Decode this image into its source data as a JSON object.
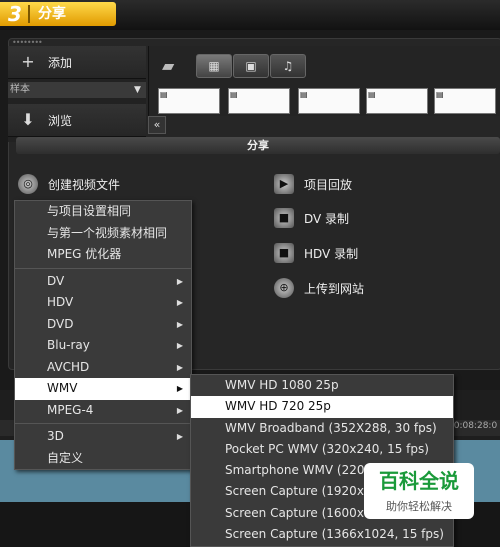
{
  "step": {
    "number": "3",
    "label": "分享"
  },
  "library": {
    "add_label": "添加",
    "sample_label": "样本",
    "browse_label": "浏览",
    "collapse_glyph": "«",
    "media_types": [
      "video",
      "image",
      "audio"
    ]
  },
  "share": {
    "section_title": "分享",
    "create_video": "创建视频文件",
    "project_playback": "项目回放",
    "dv_record": "DV 录制",
    "hdv_record": "HDV 录制",
    "upload": "上传到网站"
  },
  "menu1": {
    "items": [
      {
        "label": "与项目设置相同"
      },
      {
        "label": "与第一个视频素材相同"
      },
      {
        "label": "MPEG 优化器"
      },
      {
        "label": "DV"
      },
      {
        "label": "HDV"
      },
      {
        "label": "DVD"
      },
      {
        "label": "Blu-ray"
      },
      {
        "label": "AVCHD"
      },
      {
        "label": "WMV"
      },
      {
        "label": "MPEG-4"
      },
      {
        "label": "3D"
      },
      {
        "label": "自定义"
      }
    ],
    "highlighted": "WMV"
  },
  "menu2": {
    "items": [
      {
        "label": "WMV HD 1080 25p"
      },
      {
        "label": "WMV HD 720 25p"
      },
      {
        "label": "WMV Broadband  (352X288, 30 fps)"
      },
      {
        "label": "Pocket PC WMV  (320x240, 15 fps)"
      },
      {
        "label": "Smartphone WMV  (220"
      },
      {
        "label": "Screen Capture (1920x1"
      },
      {
        "label": "Screen Capture (1600x9"
      },
      {
        "label": "Screen Capture (1366x1024, 15 fps)"
      }
    ],
    "highlighted": "WMV HD 720 25p"
  },
  "timeline": {
    "time_readout": "00:08:28:0"
  },
  "watermark": {
    "main": "百科全说",
    "sub": "助你轻松解决"
  },
  "colors": {
    "step_accent": "#f5b800",
    "highlight": "#ffffff",
    "watermark_green": "#1a9a3a"
  }
}
